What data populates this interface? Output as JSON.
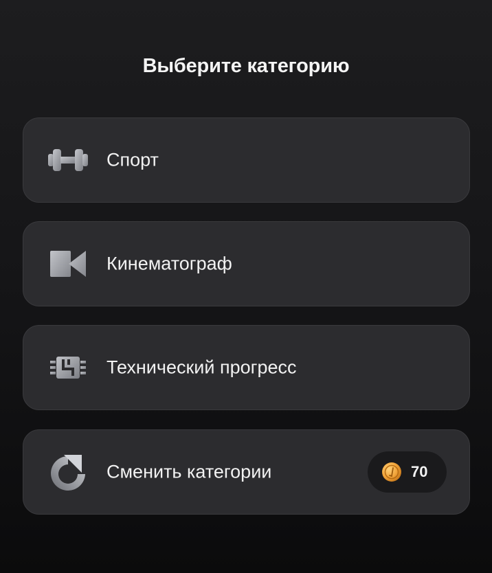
{
  "header": {
    "title": "Выберите категорию"
  },
  "categories": [
    {
      "label": "Спорт",
      "icon": "dumbbell-icon"
    },
    {
      "label": "Кинематограф",
      "icon": "video-camera-icon"
    },
    {
      "label": "Технический прогресс",
      "icon": "microchip-icon"
    }
  ],
  "change": {
    "label": "Сменить категории",
    "icon": "refresh-arrow-icon",
    "price": "70",
    "price_icon": "coin-icon"
  },
  "colors": {
    "card_bg": "#2c2c2f",
    "icon_gray": "#a4a6ab",
    "coin_gold": "#f2a53b"
  }
}
